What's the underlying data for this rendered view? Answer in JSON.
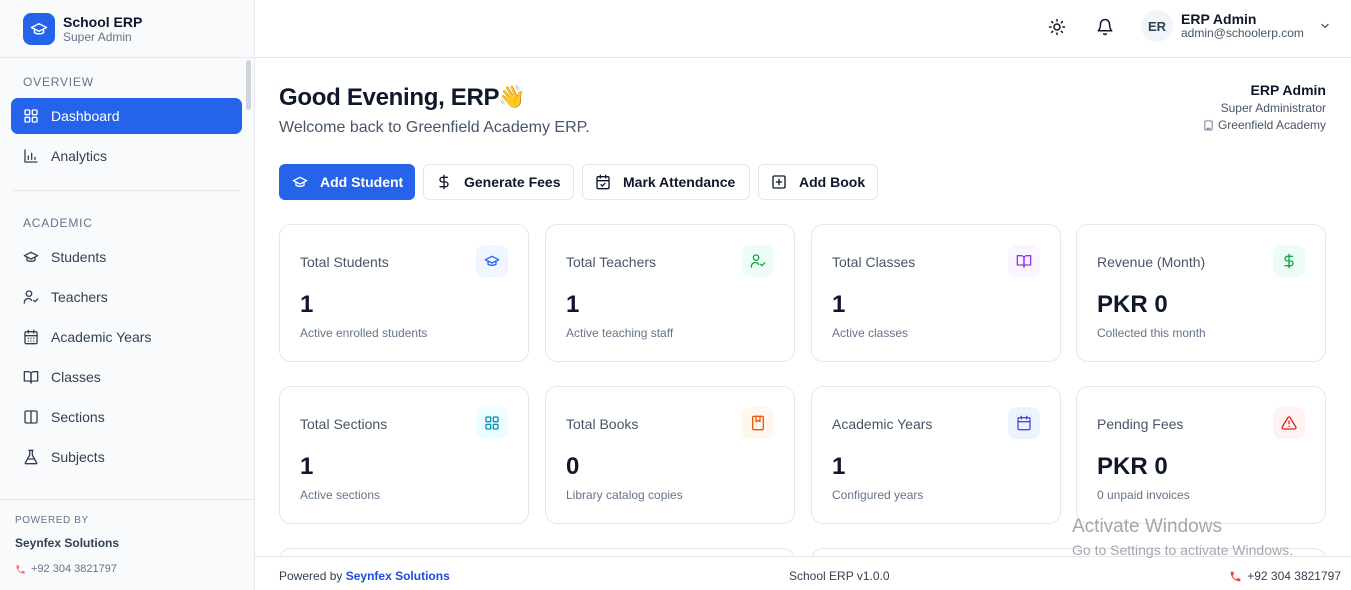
{
  "brand": {
    "title": "School ERP",
    "subtitle": "Super Admin"
  },
  "sidebar": {
    "sections": [
      {
        "label": "OVERVIEW",
        "items": [
          {
            "label": "Dashboard",
            "icon": "grid-icon",
            "active": true
          },
          {
            "label": "Analytics",
            "icon": "bar-chart-icon"
          }
        ]
      },
      {
        "label": "ACADEMIC",
        "items": [
          {
            "label": "Students",
            "icon": "graduation-cap-icon"
          },
          {
            "label": "Teachers",
            "icon": "user-check-icon"
          },
          {
            "label": "Academic Years",
            "icon": "calendar-icon"
          },
          {
            "label": "Classes",
            "icon": "book-open-icon"
          },
          {
            "label": "Sections",
            "icon": "columns-icon"
          },
          {
            "label": "Subjects",
            "icon": "flask-icon"
          }
        ]
      }
    ],
    "footer": {
      "powered_label": "POWERED BY",
      "company": "Seynfex Solutions",
      "phone": "+92 304 3821797"
    }
  },
  "topbar": {
    "avatar_initials": "ER",
    "user_name": "ERP Admin",
    "user_email": "admin@schoolerp.com"
  },
  "header": {
    "greeting": "Good Evening, ERP",
    "wave": "👋",
    "welcome": "Welcome back to Greenfield Academy ERP.",
    "info_name": "ERP Admin",
    "info_role": "Super Administrator",
    "info_school": "Greenfield Academy"
  },
  "actions": [
    {
      "label": "Add Student",
      "icon": "graduation-cap-icon",
      "primary": true
    },
    {
      "label": "Generate Fees",
      "icon": "dollar-icon"
    },
    {
      "label": "Mark Attendance",
      "icon": "calendar-check-icon"
    },
    {
      "label": "Add Book",
      "icon": "plus-square-icon"
    }
  ],
  "stats": [
    {
      "title": "Total Students",
      "value": "1",
      "subtitle": "Active enrolled students",
      "icon": "graduation-cap-icon",
      "color": "#2563eb",
      "bg": "#eff6ff"
    },
    {
      "title": "Total Teachers",
      "value": "1",
      "subtitle": "Active teaching staff",
      "icon": "user-check-icon",
      "color": "#16a34a",
      "bg": "#ecfdf5"
    },
    {
      "title": "Total Classes",
      "value": "1",
      "subtitle": "Active classes",
      "icon": "book-open-icon",
      "color": "#9333ea",
      "bg": "#faf5ff"
    },
    {
      "title": "Revenue (Month)",
      "value": "PKR 0",
      "subtitle": "Collected this month",
      "icon": "dollar-icon",
      "color": "#16a34a",
      "bg": "#ecfdf5"
    },
    {
      "title": "Total Sections",
      "value": "1",
      "subtitle": "Active sections",
      "icon": "grid-icon",
      "color": "#0891b2",
      "bg": "#ecfeff"
    },
    {
      "title": "Total Books",
      "value": "0",
      "subtitle": "Library catalog copies",
      "icon": "book-icon",
      "color": "#ea580c",
      "bg": "#fff7ed"
    },
    {
      "title": "Academic Years",
      "value": "1",
      "subtitle": "Configured years",
      "icon": "calendar-icon",
      "color": "#4f46e5",
      "bg": "#eef2ff"
    },
    {
      "title": "Pending Fees",
      "value": "PKR 0",
      "subtitle": "0 unpaid invoices",
      "icon": "alert-triangle-icon",
      "color": "#dc2626",
      "bg": "#fef2f2"
    }
  ],
  "footer": {
    "powered_prefix": "Powered by",
    "company": "Seynfex Solutions",
    "version": "School ERP v1.0.0",
    "phone": "+92 304 3821797"
  },
  "watermark": {
    "line1": "Activate Windows",
    "line2": "Go to Settings to activate Windows."
  }
}
